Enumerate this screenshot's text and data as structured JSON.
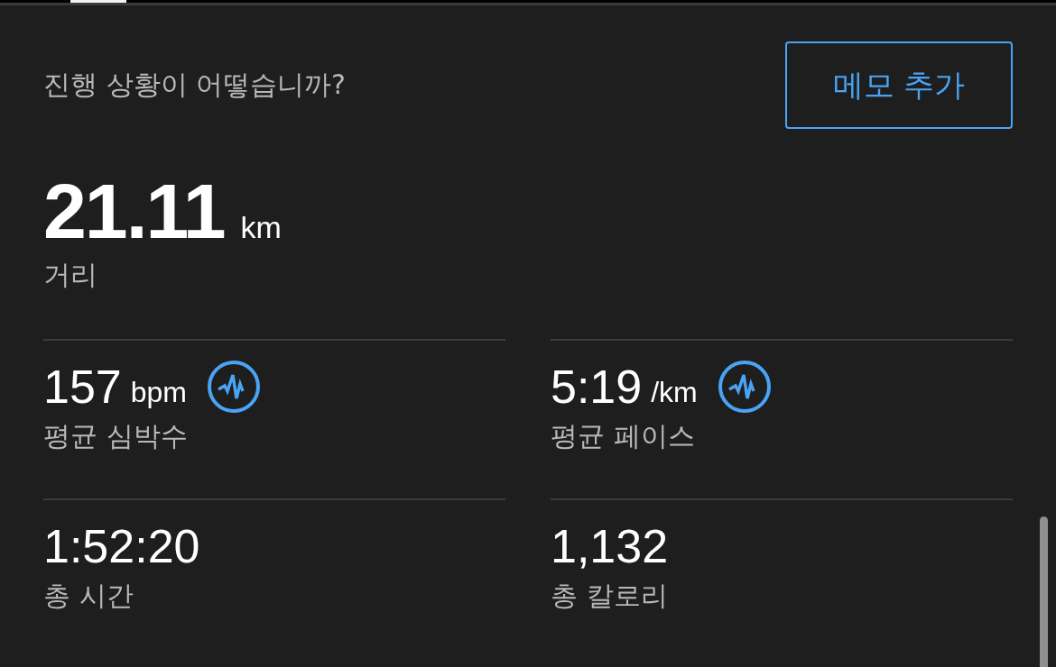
{
  "prompt": "진행 상황이 어떻습니까?",
  "memo_button": "메모 추가",
  "distance": {
    "value": "21.11",
    "unit": "km",
    "label": "거리"
  },
  "stats": [
    {
      "value": "157",
      "unit": "bpm",
      "label": "평균 심박수",
      "has_chart_icon": true
    },
    {
      "value": "5:19",
      "unit": "/km",
      "label": "평균 페이스",
      "has_chart_icon": true
    },
    {
      "value": "1:52:20",
      "label": "총 시간",
      "has_chart_icon": false
    },
    {
      "value": "1,132",
      "label": "총 칼로리",
      "has_chart_icon": false
    }
  ]
}
